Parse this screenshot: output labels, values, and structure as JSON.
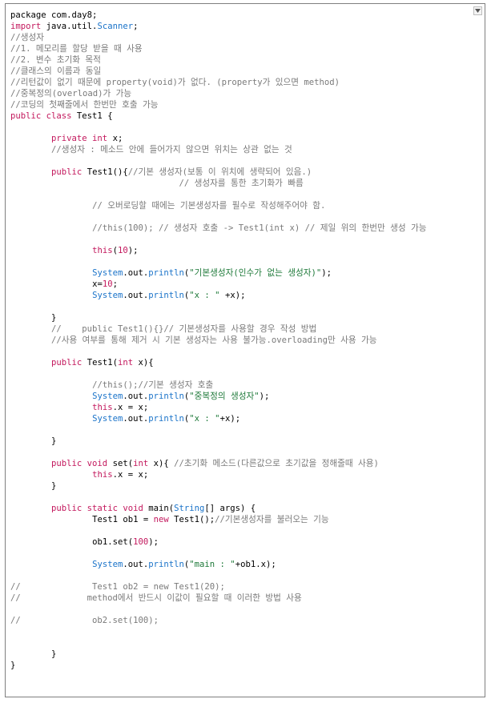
{
  "editor": {
    "scroll_icon": "chevron-down-icon",
    "lines": [
      [
        [
          "package com.day8;",
          "p"
        ]
      ],
      [
        [
          "import ",
          "k"
        ],
        [
          "java.util.",
          "p"
        ],
        [
          "Scanner",
          "t"
        ],
        [
          ";",
          "p"
        ]
      ],
      [
        [
          "//생성자",
          "c"
        ]
      ],
      [
        [
          "//1. 메모리를 할당 받을 때 사용",
          "c"
        ]
      ],
      [
        [
          "//2. 변수 초기화 목적",
          "c"
        ]
      ],
      [
        [
          "//클래스의 이름과 동일",
          "c"
        ]
      ],
      [
        [
          "//리턴값이 없기 때문에 property(void)가 없다. (property가 있으면 method)",
          "c"
        ]
      ],
      [
        [
          "//중복정의(overload)가 가능",
          "c"
        ]
      ],
      [
        [
          "//코딩의 첫째줄에서 한번만 호출 가능",
          "c"
        ]
      ],
      [
        [
          "public class ",
          "k"
        ],
        [
          "Test1 {",
          "p"
        ]
      ],
      [],
      [
        [
          "        ",
          "p"
        ],
        [
          "private int ",
          "k"
        ],
        [
          "x;",
          "p"
        ]
      ],
      [
        [
          "        ",
          "p"
        ],
        [
          "//생성자 : 메소드 안에 들어가지 않으면 위치는 상관 없는 것",
          "c"
        ]
      ],
      [],
      [
        [
          "        ",
          "p"
        ],
        [
          "public ",
          "k"
        ],
        [
          "Test1(){",
          "p"
        ],
        [
          "//기본 생성자(보통 이 위치에 생략되어 있음.)",
          "c"
        ]
      ],
      [
        [
          "                                 // 생성자를 통한 초기화가 빠름",
          "c"
        ]
      ],
      [],
      [
        [
          "                ",
          "p"
        ],
        [
          "// 오버로딩할 때에는 기본생성자를 필수로 작성해주어야 함.",
          "c"
        ]
      ],
      [],
      [
        [
          "                ",
          "p"
        ],
        [
          "//this(100); // 생성자 호출 -> Test1(int x) // 제일 위의 한번만 생성 가능",
          "c"
        ]
      ],
      [],
      [
        [
          "                ",
          "p"
        ],
        [
          "this",
          "k"
        ],
        [
          "(",
          "p"
        ],
        [
          "10",
          "n"
        ],
        [
          ");",
          "p"
        ]
      ],
      [],
      [
        [
          "                ",
          "p"
        ],
        [
          "System",
          "t"
        ],
        [
          ".out.",
          "p"
        ],
        [
          "println",
          "t"
        ],
        [
          "(",
          "p"
        ],
        [
          "\"기본생성자(인수가 없는 생성자)\"",
          "s"
        ],
        [
          ");",
          "p"
        ]
      ],
      [
        [
          "                ",
          "p"
        ],
        [
          "x=",
          "p"
        ],
        [
          "10",
          "n"
        ],
        [
          ";",
          "p"
        ]
      ],
      [
        [
          "                ",
          "p"
        ],
        [
          "System",
          "t"
        ],
        [
          ".out.",
          "p"
        ],
        [
          "println",
          "t"
        ],
        [
          "(",
          "p"
        ],
        [
          "\"x : \"",
          "s"
        ],
        [
          " +x);",
          "p"
        ]
      ],
      [],
      [
        [
          "        }",
          "p"
        ]
      ],
      [
        [
          "        ",
          "p"
        ],
        [
          "//    public Test1(){}// 기본생성자를 사용할 경우 작성 방법",
          "c"
        ]
      ],
      [
        [
          "        ",
          "p"
        ],
        [
          "//사용 여부를 통해 제거 시 기본 생성자는 사용 불가능.overloading만 사용 가능",
          "c"
        ]
      ],
      [],
      [
        [
          "        ",
          "p"
        ],
        [
          "public ",
          "k"
        ],
        [
          "Test1(",
          "p"
        ],
        [
          "int ",
          "k"
        ],
        [
          "x){",
          "p"
        ]
      ],
      [],
      [
        [
          "                ",
          "p"
        ],
        [
          "//this();//기본 생성자 호출",
          "c"
        ]
      ],
      [
        [
          "                ",
          "p"
        ],
        [
          "System",
          "t"
        ],
        [
          ".out.",
          "p"
        ],
        [
          "println",
          "t"
        ],
        [
          "(",
          "p"
        ],
        [
          "\"중복정의 생성자\"",
          "s"
        ],
        [
          ");",
          "p"
        ]
      ],
      [
        [
          "                ",
          "p"
        ],
        [
          "this",
          "k"
        ],
        [
          ".x = x;",
          "p"
        ]
      ],
      [
        [
          "                ",
          "p"
        ],
        [
          "System",
          "t"
        ],
        [
          ".out.",
          "p"
        ],
        [
          "println",
          "t"
        ],
        [
          "(",
          "p"
        ],
        [
          "\"x : \"",
          "s"
        ],
        [
          "+x);",
          "p"
        ]
      ],
      [],
      [
        [
          "        }",
          "p"
        ]
      ],
      [],
      [
        [
          "        ",
          "p"
        ],
        [
          "public void ",
          "k"
        ],
        [
          "set(",
          "p"
        ],
        [
          "int ",
          "k"
        ],
        [
          "x){ ",
          "p"
        ],
        [
          "//초기화 메소드(다른값으로 초기값을 정해줄때 사용)",
          "c"
        ]
      ],
      [
        [
          "                ",
          "p"
        ],
        [
          "this",
          "k"
        ],
        [
          ".x = x;",
          "p"
        ]
      ],
      [
        [
          "        }",
          "p"
        ]
      ],
      [],
      [
        [
          "        ",
          "p"
        ],
        [
          "public static void ",
          "k"
        ],
        [
          "main(",
          "p"
        ],
        [
          "String",
          "t"
        ],
        [
          "[] args) {",
          "p"
        ]
      ],
      [
        [
          "                ",
          "p"
        ],
        [
          "Test1 ob1 = ",
          "p"
        ],
        [
          "new ",
          "k"
        ],
        [
          "Test1();",
          "p"
        ],
        [
          "//기본생성자를 불러오는 기능",
          "c"
        ]
      ],
      [],
      [
        [
          "                ",
          "p"
        ],
        [
          "ob1.set(",
          "p"
        ],
        [
          "100",
          "n"
        ],
        [
          ");",
          "p"
        ]
      ],
      [],
      [
        [
          "                ",
          "p"
        ],
        [
          "System",
          "t"
        ],
        [
          ".out.",
          "p"
        ],
        [
          "println",
          "t"
        ],
        [
          "(",
          "p"
        ],
        [
          "\"main : \"",
          "s"
        ],
        [
          "+ob1.x);",
          "p"
        ]
      ],
      [],
      [
        [
          "//              Test1 ob2 = new Test1(20);",
          "c"
        ]
      ],
      [
        [
          "//             method에서 반드시 이값이 필요할 때 이러한 방법 사용",
          "c"
        ]
      ],
      [],
      [
        [
          "//              ob2.set(100);",
          "c"
        ]
      ],
      [],
      [],
      [
        [
          "        }",
          "p"
        ]
      ],
      [
        [
          "}",
          "p"
        ]
      ]
    ]
  }
}
